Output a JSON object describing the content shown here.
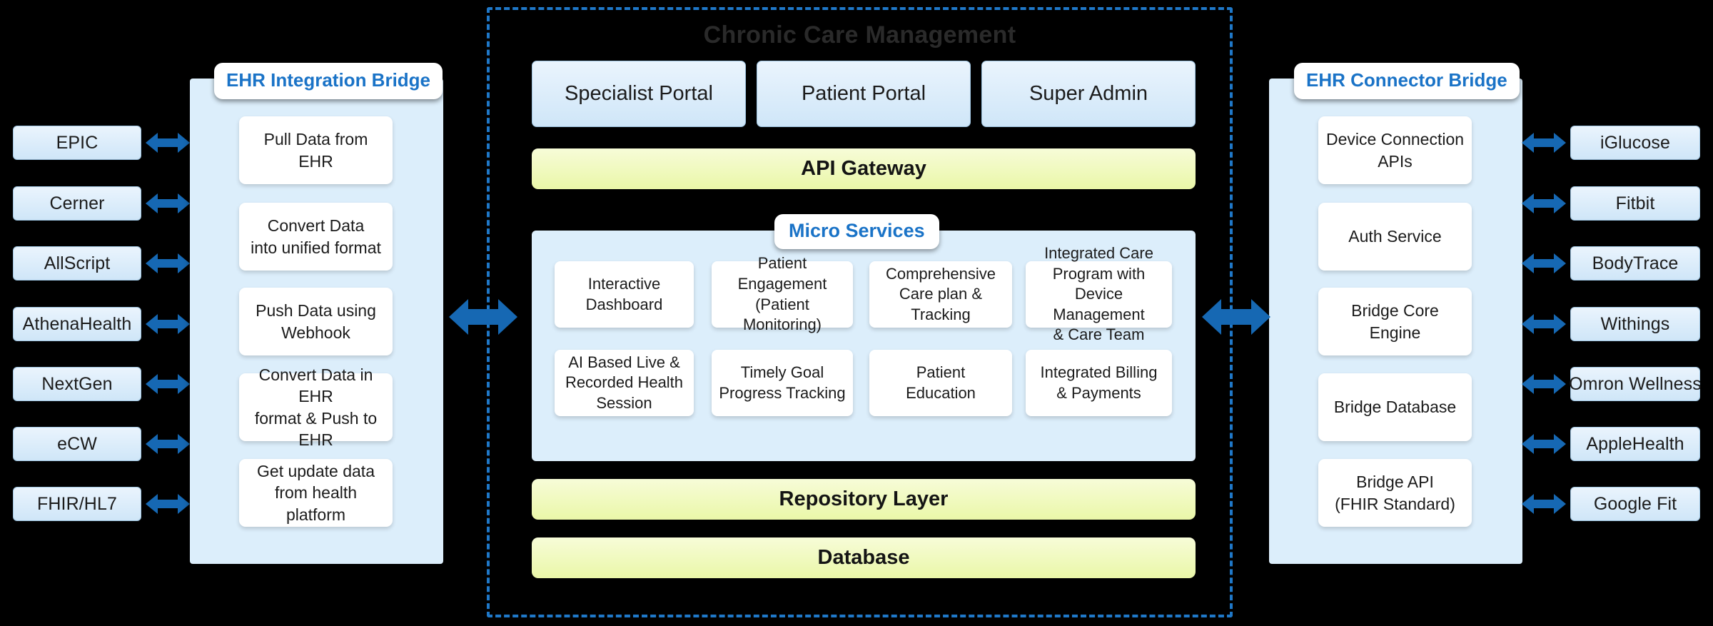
{
  "background_color": "#000000",
  "accent_color": "#1a73c7",
  "arrow_color": "#1668b3",
  "boundary_color": "#1f78c8",
  "center": {
    "title": "Chronic Care Management",
    "portals": [
      {
        "label": "Specialist Portal"
      },
      {
        "label": "Patient Portal"
      },
      {
        "label": "Super Admin"
      }
    ],
    "api_gateway": "API Gateway",
    "micro_services": {
      "title": "Micro Services",
      "items": [
        {
          "label": "Interactive\nDashboard"
        },
        {
          "label": "Patient\nEngagement\n(Patient Monitoring)"
        },
        {
          "label": "Comprehensive\nCare plan &\nTracking"
        },
        {
          "label": "Integrated Care\nProgram with\nDevice Management\n& Care Team"
        },
        {
          "label": "AI Based Live &\nRecorded Health\nSession"
        },
        {
          "label": "Timely Goal\nProgress Tracking"
        },
        {
          "label": "Patient\nEducation"
        },
        {
          "label": "Integrated Billing\n& Payments"
        }
      ]
    },
    "repository_layer": "Repository Layer",
    "database": "Database"
  },
  "left": {
    "systems": [
      {
        "label": "EPIC"
      },
      {
        "label": "Cerner"
      },
      {
        "label": "AllScript"
      },
      {
        "label": "AthenaHealth"
      },
      {
        "label": "NextGen"
      },
      {
        "label": "eCW"
      },
      {
        "label": "FHIR/HL7"
      }
    ],
    "bridge": {
      "title": "EHR Integration Bridge",
      "cards": [
        {
          "label": "Pull Data from\nEHR"
        },
        {
          "label": "Convert Data\ninto unified format"
        },
        {
          "label": "Push Data using\nWebhook"
        },
        {
          "label": "Convert Data in EHR\nformat & Push to EHR"
        },
        {
          "label": "Get update data\nfrom health platform"
        }
      ]
    }
  },
  "right": {
    "bridge": {
      "title": "EHR Connector Bridge",
      "cards": [
        {
          "label": "Device Connection\nAPIs"
        },
        {
          "label": "Auth Service"
        },
        {
          "label": "Bridge Core\nEngine"
        },
        {
          "label": "Bridge Database"
        },
        {
          "label": "Bridge API\n(FHIR Standard)"
        }
      ]
    },
    "devices": [
      {
        "label": "iGlucose"
      },
      {
        "label": "Fitbit"
      },
      {
        "label": "BodyTrace"
      },
      {
        "label": "Withings"
      },
      {
        "label": "Omron Wellness"
      },
      {
        "label": "AppleHealth"
      },
      {
        "label": "Google Fit"
      }
    ]
  }
}
